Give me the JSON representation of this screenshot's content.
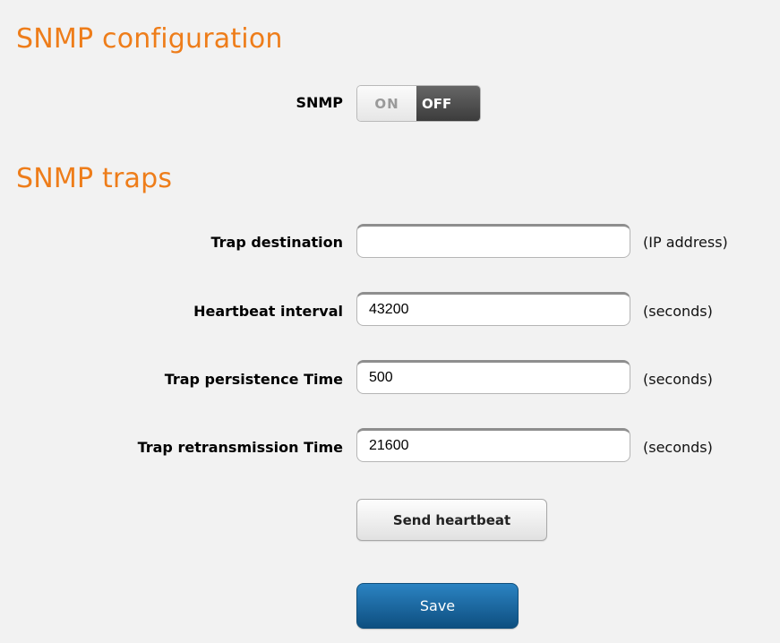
{
  "snmp_configuration": {
    "title": "SNMP configuration",
    "snmp_label": "SNMP",
    "toggle": {
      "on_label": "ON",
      "off_label": "OFF",
      "state": "OFF"
    }
  },
  "snmp_traps": {
    "title": "SNMP traps",
    "fields": [
      {
        "label": "Trap destination",
        "value": "",
        "unit": "(IP address)"
      },
      {
        "label": "Heartbeat interval",
        "value": "43200",
        "unit": "(seconds)"
      },
      {
        "label": "Trap persistence Time",
        "value": "500",
        "unit": "(seconds)"
      },
      {
        "label": "Trap retransmission Time",
        "value": "21600",
        "unit": "(seconds)"
      }
    ],
    "send_heartbeat_label": "Send heartbeat"
  },
  "save_label": "Save",
  "colors": {
    "section_title": "#ee7d1a",
    "save_button": "#1a6aa6",
    "toggle_off_bg": "#4a4a4a"
  }
}
